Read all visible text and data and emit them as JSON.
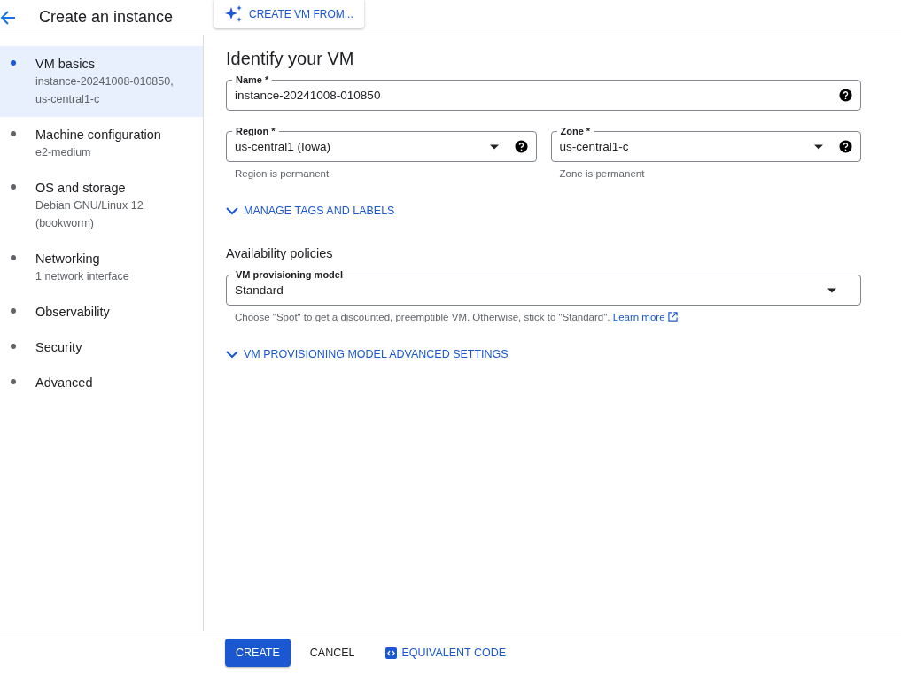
{
  "header": {
    "title": "Create an instance",
    "action": "CREATE VM FROM..."
  },
  "sidebar": {
    "items": [
      {
        "title": "VM basics",
        "subtitle": "instance-20241008-010850, us-central1-c",
        "selected": true
      },
      {
        "title": "Machine configuration",
        "subtitle": "e2-medium",
        "selected": false
      },
      {
        "title": "OS and storage",
        "subtitle": "Debian GNU/Linux 12 (bookworm)",
        "selected": false
      },
      {
        "title": "Networking",
        "subtitle": "1 network interface",
        "selected": false
      },
      {
        "title": "Observability",
        "selected": false
      },
      {
        "title": "Security",
        "selected": false
      },
      {
        "title": "Advanced",
        "selected": false
      }
    ]
  },
  "section": {
    "title": "Identify your VM",
    "name_field": {
      "label": "Name *",
      "value": "instance-20241008-010850",
      "help": true
    },
    "location_fields": [
      {
        "kind": "select",
        "label": "Region *",
        "value": "us-central1 (Iowa)",
        "help": true,
        "helper": "Region is permanent"
      },
      {
        "kind": "select",
        "label": "Zone *",
        "value": "us-central1-c",
        "help": true,
        "helper": "Zone is permanent"
      }
    ],
    "expander": "MANAGE TAGS AND LABELS"
  },
  "availability": {
    "title": "Availability policies",
    "field": {
      "kind": "select",
      "label": "VM provisioning model",
      "value": "Standard",
      "help": false
    },
    "helper": "Choose \"Spot\" to get a discounted, preemptible VM. Otherwise, stick to \"Standard\".",
    "link": "Learn more",
    "expander": "VM PROVISIONING MODEL ADVANCED SETTINGS"
  },
  "footer": {
    "primary": "CREATE",
    "cancel": "CANCEL",
    "code": "EQUIVALENT CODE"
  }
}
